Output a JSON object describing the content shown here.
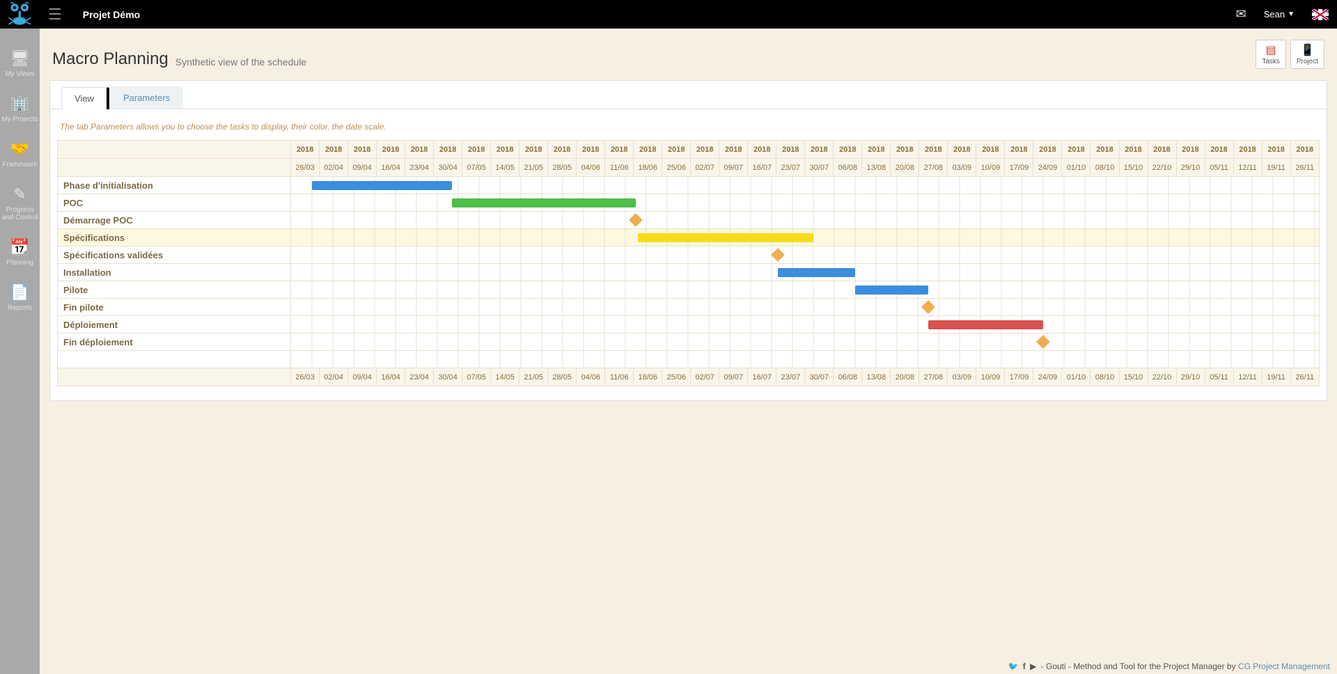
{
  "header": {
    "project_title": "Projet Démo",
    "user_name": "Sean"
  },
  "sidebar": {
    "items": [
      {
        "icon": "monitor",
        "label": "My Views"
      },
      {
        "icon": "building",
        "label": "My Projects"
      },
      {
        "icon": "handshake",
        "label": "Framework"
      },
      {
        "icon": "edit",
        "label": "Progress and Control"
      },
      {
        "icon": "calendar",
        "label": "Planning"
      },
      {
        "icon": "file",
        "label": "Reports"
      }
    ]
  },
  "page": {
    "title": "Macro Planning",
    "subtitle": "Synthetic view of the schedule",
    "buttons": {
      "tasks": "Tasks",
      "project": "Project"
    }
  },
  "tabs": {
    "view": "View",
    "parameters": "Parameters"
  },
  "hint": "The tab Parameters allows you to choose the tasks to display, their color, the date scale.",
  "chart_data": {
    "type": "bar",
    "title": "Macro Planning",
    "year": "2018",
    "weeks": [
      "26/03",
      "02/04",
      "09/04",
      "16/04",
      "23/04",
      "30/04",
      "07/05",
      "14/05",
      "21/05",
      "28/05",
      "04/06",
      "11/06",
      "18/06",
      "25/06",
      "02/07",
      "09/07",
      "16/07",
      "23/07",
      "30/07",
      "06/08",
      "13/08",
      "20/08",
      "27/08",
      "03/09",
      "10/09",
      "17/09",
      "24/09",
      "01/10",
      "08/10",
      "15/10",
      "22/10",
      "29/10",
      "05/11",
      "12/11",
      "19/11",
      "26/11"
    ],
    "tasks": [
      {
        "name": "Phase d'initialisation",
        "type": "bar",
        "color": "blue",
        "start": 1,
        "end": 7.7
      },
      {
        "name": "POC",
        "type": "bar",
        "color": "green",
        "start": 7.7,
        "end": 16.5
      },
      {
        "name": "Démarrage POC",
        "type": "milestone",
        "color": "orange",
        "at": 16.5
      },
      {
        "name": "Spécifications",
        "type": "bar",
        "color": "yellow",
        "highlight": true,
        "start": 16.6,
        "end": 25
      },
      {
        "name": "Spécifications validées",
        "type": "milestone",
        "color": "orange",
        "at": 23.3
      },
      {
        "name": "Installation",
        "type": "bar",
        "color": "blue",
        "start": 23.3,
        "end": 27
      },
      {
        "name": "Pilote",
        "type": "bar",
        "color": "blue",
        "start": 27,
        "end": 30.5
      },
      {
        "name": "Fin pilote",
        "type": "milestone",
        "color": "orange",
        "at": 30.5
      },
      {
        "name": "Déploiement",
        "type": "bar",
        "color": "red",
        "start": 30.5,
        "end": 36
      },
      {
        "name": "Fin déploiement",
        "type": "milestone",
        "color": "orange",
        "at": 36
      }
    ]
  },
  "footer": {
    "text1": " - Gouti - Method and Tool for the Project Manager by ",
    "link": "CG Project Management"
  }
}
